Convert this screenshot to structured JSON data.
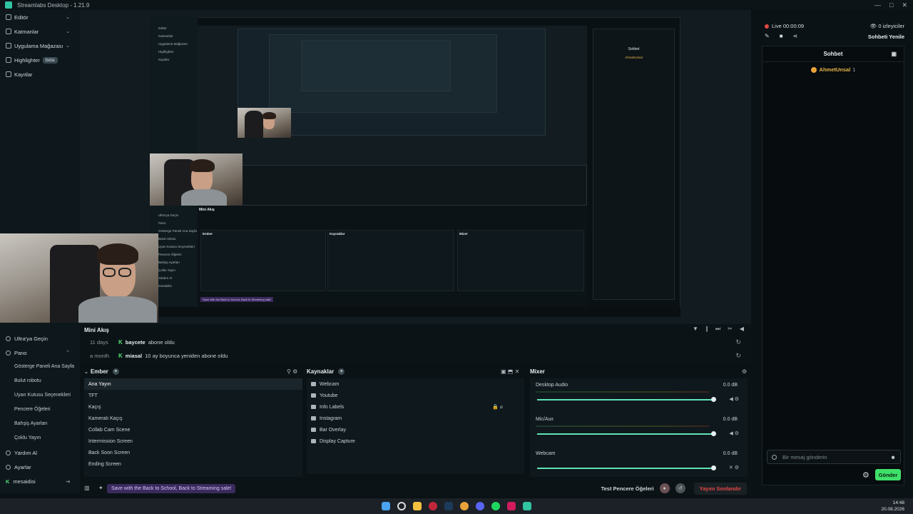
{
  "titlebar": {
    "title": "Streamlabs Desktop - 1.21.9",
    "controls": [
      "—",
      "□",
      "✕"
    ]
  },
  "top_left_nav": [
    {
      "label": "Editör",
      "chevron": "⌄"
    },
    {
      "label": "Katmanlar",
      "chevron": "⌄"
    },
    {
      "label": "Uygulama Mağazası",
      "chevron": "⌄"
    },
    {
      "label": "Highlighter",
      "badge": "beta"
    },
    {
      "label": "Kayıtlar"
    }
  ],
  "live_status": {
    "time": "Live 00:00:09",
    "viewers": "0 izleyiciler",
    "refresh_chat": "Sohbeti Yenile"
  },
  "chat": {
    "title": "Sohbet",
    "user": "AhmetUnsal",
    "user_count": "1",
    "input_placeholder": "Bir mesaj gönderin",
    "send_label": "Gönder"
  },
  "left_nav": {
    "ultra": "Ultra'ya Geçin",
    "pano": "Pano",
    "pano_items": [
      "Gösterge Paneli Ana Sayfa",
      "Bulut robotu",
      "Uyarı Kutusu Seçenekleri",
      "Pencere Öğeleri",
      "Bahşiş Ayarları",
      "Çoklu Yayın"
    ],
    "help": "Yardım Al",
    "settings": "Ayarlar",
    "account": "mesaidisi"
  },
  "mini_feed": {
    "title": "Mini Akış",
    "rows": [
      {
        "ago": "11 days",
        "user": "baycete",
        "text": "abone oldu"
      },
      {
        "ago": "a month",
        "user": "miasal",
        "text": "10 ay boyunca yeniden abone oldu"
      }
    ]
  },
  "scenes": {
    "title": "Ember",
    "items": [
      "Ana Yayın",
      "TFT",
      "Kaçış",
      "Kameralı Kaçış",
      "Collab Cam Scene",
      "Intermission Screen",
      "Back Soon Screen",
      "Ending Screen"
    ]
  },
  "sources": {
    "title": "Kaynaklar",
    "items": [
      "Webcam",
      "Youtube",
      "Info Labels",
      "Instagram",
      "Bar Overlay",
      "Display Capture"
    ]
  },
  "mixer": {
    "title": "Mixer",
    "channels": [
      {
        "name": "Desktop Audio",
        "db": "0.0 dB"
      },
      {
        "name": "Mic/Aux",
        "db": "0.0 dB"
      },
      {
        "name": "Webcam",
        "db": "0.0 dB"
      }
    ]
  },
  "footer": {
    "promo": "Save with the Back to School, Back to Streaming sale!",
    "test_windows": "Test Pencere Öğeleri",
    "end_stream": "Yayını Sonlandır"
  },
  "taskbar": {
    "time": "14:48",
    "date": "20.08.2026"
  },
  "colors": {
    "accent": "#31c3a2",
    "live": "#e5483f",
    "send": "#3fe06a",
    "end_stream": "#e54848"
  }
}
